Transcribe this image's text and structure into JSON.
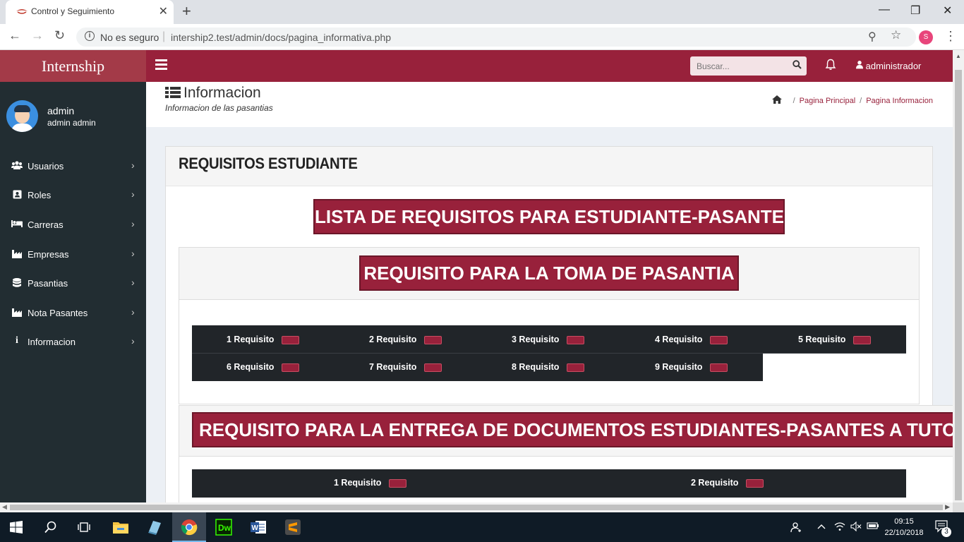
{
  "browser": {
    "tab_title": "Control y Seguimiento",
    "security_label": "No es seguro",
    "url": "intership2.test/admin/docs/pagina_informativa.php",
    "profile_initial": "S"
  },
  "header": {
    "brand": "Internship",
    "search_placeholder": "Buscar...",
    "username": "administrador"
  },
  "sidebar": {
    "user_name": "admin",
    "user_full": "admin admin",
    "items": [
      {
        "label": "Usuarios",
        "icon": "users-icon"
      },
      {
        "label": "Roles",
        "icon": "id-card-icon"
      },
      {
        "label": "Carreras",
        "icon": "bed-icon"
      },
      {
        "label": "Empresas",
        "icon": "industry-icon"
      },
      {
        "label": "Pasantias",
        "icon": "database-icon"
      },
      {
        "label": "Nota Pasantes",
        "icon": "industry-icon"
      },
      {
        "label": "Informacion",
        "icon": "info-icon"
      }
    ]
  },
  "page": {
    "title": "Informacion",
    "subtitle": "Informacion de las pasantias",
    "breadcrumb": [
      "Pagina Principal",
      "Pagina Informacion"
    ]
  },
  "box": {
    "title": "REQUISITOS ESTUDIANTE",
    "main_banner": "LISTA DE REQUISITOS PARA ESTUDIANTE-PASANTE",
    "section1": {
      "banner": "REQUISITO PARA LA TOMA DE PASANTIA",
      "requirements": [
        "1 Requisito",
        "2 Requisito",
        "3 Requisito",
        "4 Requisito",
        "5 Requisito",
        "6 Requisito",
        "7 Requisito",
        "8 Requisito",
        "9 Requisito"
      ]
    },
    "section2": {
      "banner": "REQUISITO PARA LA ENTREGA DE DOCUMENTOS ESTUDIANTES-PASANTES A TUTOR",
      "requirements": [
        "1 Requisito",
        "2 Requisito"
      ]
    }
  },
  "taskbar": {
    "time": "09:15",
    "date": "22/10/2018",
    "notifications": "3"
  },
  "colors": {
    "brand": "#98213b",
    "brand_light": "#a33a48",
    "sidebar": "#222d32",
    "table": "#212529"
  }
}
